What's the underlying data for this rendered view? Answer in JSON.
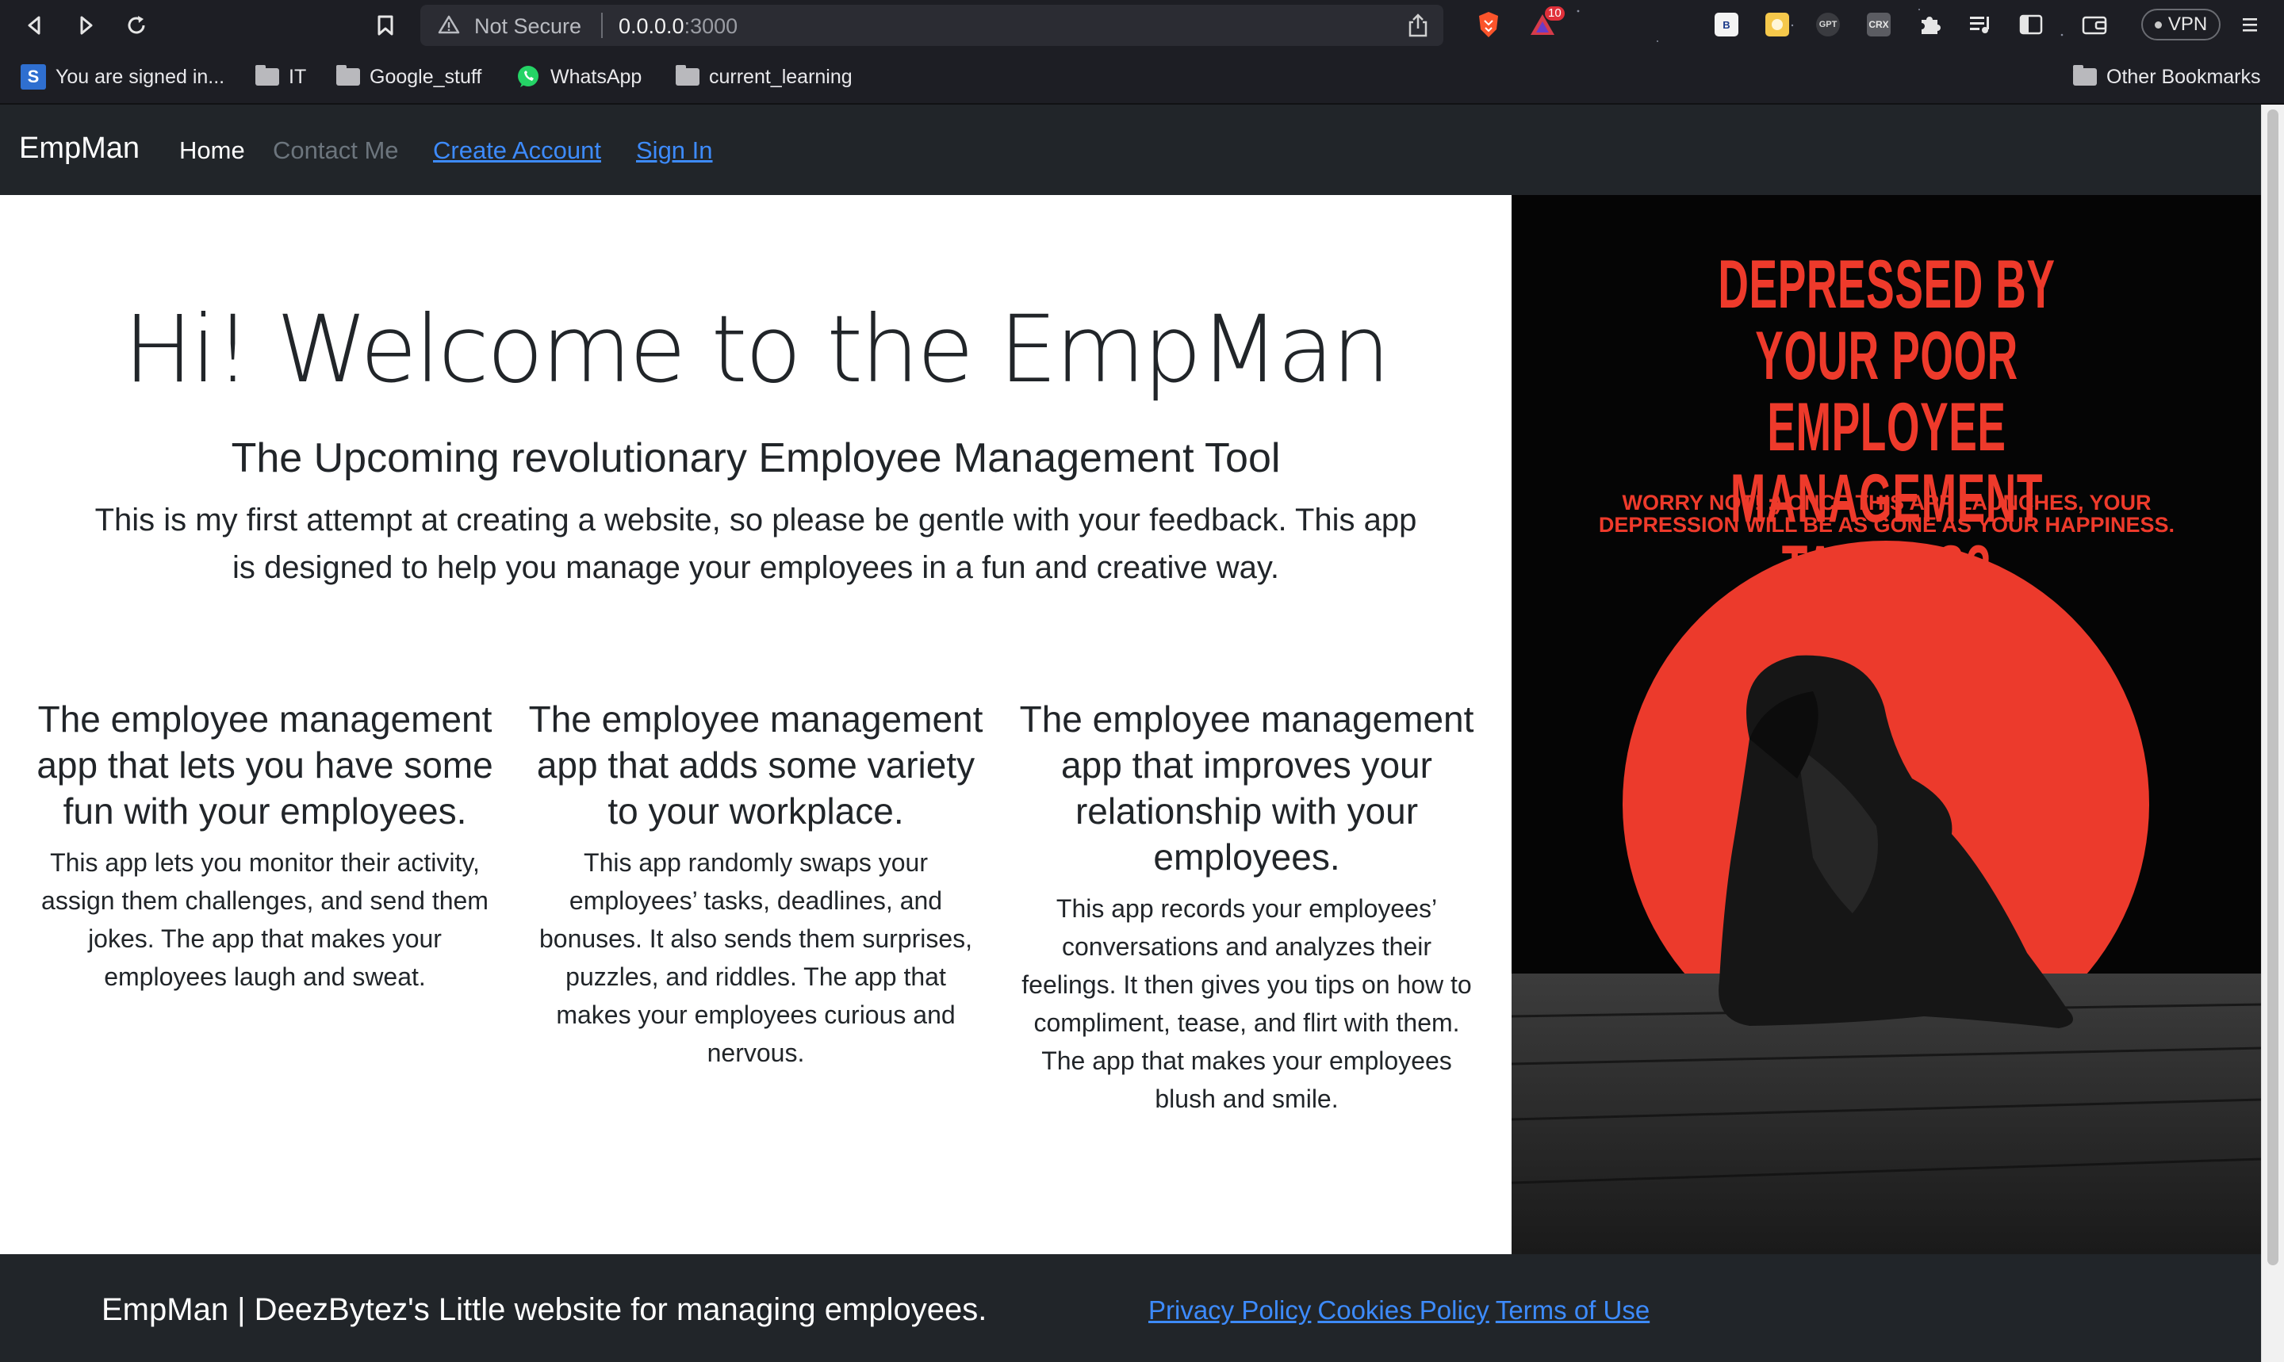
{
  "browser": {
    "security_label": "Not Secure",
    "url_host": "0.0.0.0",
    "url_port": ":3000",
    "vpn_label": "VPN",
    "brave_badge_count": "10",
    "bookmarks": [
      {
        "label": "You are signed in...",
        "icon": "s-app-icon"
      },
      {
        "label": "IT",
        "icon": "folder-icon"
      },
      {
        "label": "Google_stuff",
        "icon": "folder-icon"
      },
      {
        "label": "WhatsApp",
        "icon": "whatsapp-icon"
      },
      {
        "label": "current_learning",
        "icon": "folder-icon"
      }
    ],
    "other_bookmarks": "Other Bookmarks",
    "extensions": [
      "B",
      "",
      "GPT",
      "CRX"
    ]
  },
  "navbar": {
    "brand": "EmpMan",
    "links": [
      {
        "label": "Home",
        "style": "active"
      },
      {
        "label": "Contact Me",
        "style": "muted"
      },
      {
        "label": "Create Account",
        "style": "link"
      },
      {
        "label": "Sign In",
        "style": "link"
      }
    ]
  },
  "hero": {
    "title": "Hi! Welcome to the EmpMan",
    "subtitle": "The Upcoming revolutionary Employee Management Tool",
    "lead": "This is my first attempt at creating a website, so please be gentle with your feedback. This app is designed to help you manage your employees in a fun and creative way."
  },
  "features": [
    {
      "title": "The employee management app that lets you have some fun with your employees.",
      "body": "This app lets you monitor their activity, assign them challenges, and send them jokes. The app that makes your employees laugh and sweat."
    },
    {
      "title": "The employee management app that adds some variety to your workplace.",
      "body": "This app randomly swaps your employees’ tasks, deadlines, and bonuses. It also sends them surprises, puzzles, and riddles. The app that makes your employees curious and nervous."
    },
    {
      "title": "The employee management app that improves your relationship with your employees.",
      "body": "This app records your employees’ conversations and analyzes their feelings. It then gives you tips on how to compliment, tease, and flirt with them. The app that makes your employees blush and smile."
    }
  ],
  "poster": {
    "headline": "DEPRESSED BY YOUR POOR EMPLOYEE MANAGEMENT TACTICS?",
    "subline": "WORRY NOT! :) ONCE THIS APP LAUNCHES, YOUR DEPRESSION WILL BE AS GONE AS YOUR HAPPINESS.",
    "accent_color": "#ee3a2b"
  },
  "footer": {
    "text": "EmpMan | DeezBytez's Little website for managing employees.",
    "links": [
      "Privacy Policy",
      "Cookies Policy",
      "Terms of Use"
    ]
  },
  "colors": {
    "navbar_bg": "#212529",
    "link": "#3d8bfd",
    "muted": "#6c757d"
  }
}
